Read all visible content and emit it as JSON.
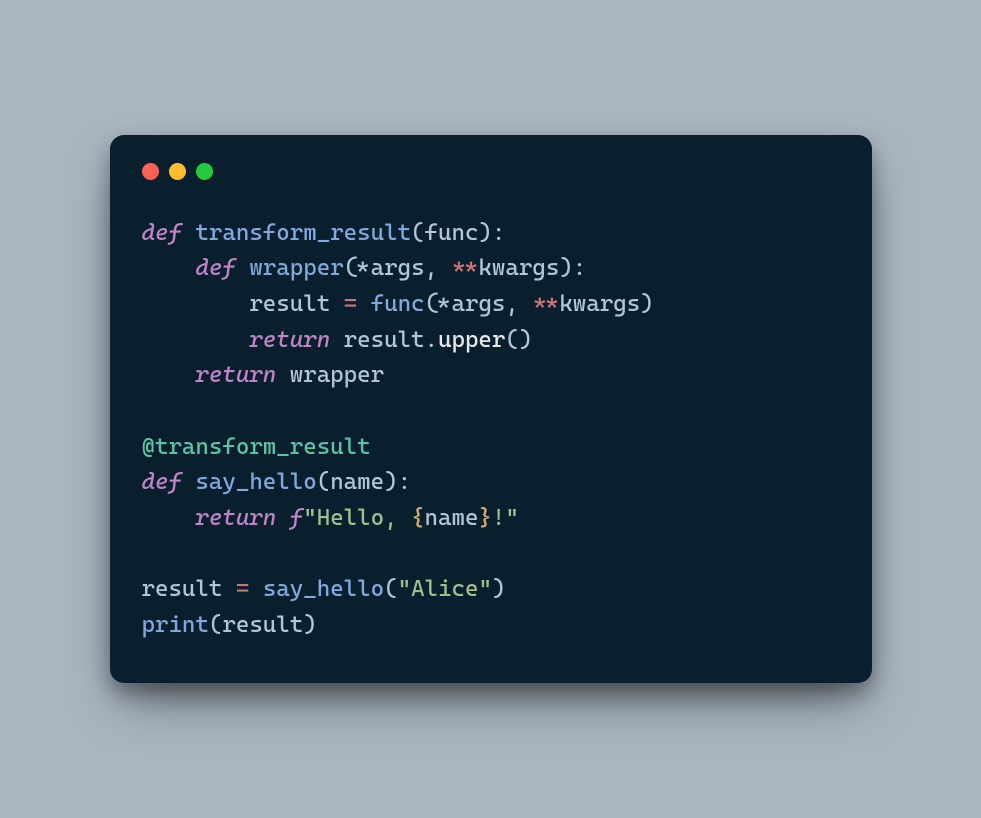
{
  "code": {
    "tokens": [
      {
        "t": "def",
        "c": "kw"
      },
      {
        "t": " ",
        "c": ""
      },
      {
        "t": "transform_result",
        "c": "fn"
      },
      {
        "t": "(",
        "c": "punct"
      },
      {
        "t": "func",
        "c": "param"
      },
      {
        "t": "):",
        "c": "punct"
      },
      {
        "t": "\n    ",
        "c": ""
      },
      {
        "t": "def",
        "c": "kw"
      },
      {
        "t": " ",
        "c": ""
      },
      {
        "t": "wrapper",
        "c": "fn"
      },
      {
        "t": "(",
        "c": "punct"
      },
      {
        "t": "*",
        "c": "op"
      },
      {
        "t": "args",
        "c": "param"
      },
      {
        "t": ", ",
        "c": "punct"
      },
      {
        "t": "**",
        "c": "op"
      },
      {
        "t": "kwargs",
        "c": "param"
      },
      {
        "t": "):",
        "c": "punct"
      },
      {
        "t": "\n        result ",
        "c": "param"
      },
      {
        "t": "=",
        "c": "op"
      },
      {
        "t": " ",
        "c": ""
      },
      {
        "t": "func",
        "c": "fn"
      },
      {
        "t": "(",
        "c": "punct"
      },
      {
        "t": "*",
        "c": "op"
      },
      {
        "t": "args",
        "c": "param"
      },
      {
        "t": ", ",
        "c": "punct"
      },
      {
        "t": "**",
        "c": "op"
      },
      {
        "t": "kwargs",
        "c": "param"
      },
      {
        "t": ")",
        "c": "punct"
      },
      {
        "t": "\n        ",
        "c": ""
      },
      {
        "t": "return",
        "c": "kw"
      },
      {
        "t": " result",
        "c": "param"
      },
      {
        "t": ".",
        "c": "punct"
      },
      {
        "t": "upper",
        "c": "method"
      },
      {
        "t": "()",
        "c": "punct"
      },
      {
        "t": "\n    ",
        "c": ""
      },
      {
        "t": "return",
        "c": "kw"
      },
      {
        "t": " wrapper",
        "c": "param"
      },
      {
        "t": "\n\n",
        "c": ""
      },
      {
        "t": "@transform_result",
        "c": "decorator"
      },
      {
        "t": "\n",
        "c": ""
      },
      {
        "t": "def",
        "c": "kw"
      },
      {
        "t": " ",
        "c": ""
      },
      {
        "t": "say_hello",
        "c": "fn"
      },
      {
        "t": "(",
        "c": "punct"
      },
      {
        "t": "name",
        "c": "param"
      },
      {
        "t": "):",
        "c": "punct"
      },
      {
        "t": "\n    ",
        "c": ""
      },
      {
        "t": "return",
        "c": "kw"
      },
      {
        "t": " ",
        "c": ""
      },
      {
        "t": "f",
        "c": "fstr"
      },
      {
        "t": "\"Hello, ",
        "c": "str"
      },
      {
        "t": "{",
        "c": "escape"
      },
      {
        "t": "name",
        "c": "param"
      },
      {
        "t": "}",
        "c": "escape"
      },
      {
        "t": "!\"",
        "c": "str"
      },
      {
        "t": "\n\nresult ",
        "c": "param"
      },
      {
        "t": "=",
        "c": "op"
      },
      {
        "t": " ",
        "c": ""
      },
      {
        "t": "say_hello",
        "c": "fn"
      },
      {
        "t": "(",
        "c": "punct"
      },
      {
        "t": "\"Alice\"",
        "c": "str"
      },
      {
        "t": ")",
        "c": "punct"
      },
      {
        "t": "\n",
        "c": ""
      },
      {
        "t": "print",
        "c": "fn"
      },
      {
        "t": "(result)",
        "c": "punct"
      }
    ]
  },
  "colors": {
    "background_page": "#a9b5c0",
    "background_window": "#0a1f2e",
    "traffic_red": "#ff5f56",
    "traffic_yellow": "#ffbd2e",
    "traffic_green": "#27c93f",
    "keyword": "#c084c6",
    "function": "#84a7de",
    "string": "#a3be8c",
    "decorator": "#5cc4a6",
    "operator": "#cc7577",
    "default": "#b3c5d8",
    "method": "#e8e8e8",
    "escape": "#d0ad6e"
  }
}
